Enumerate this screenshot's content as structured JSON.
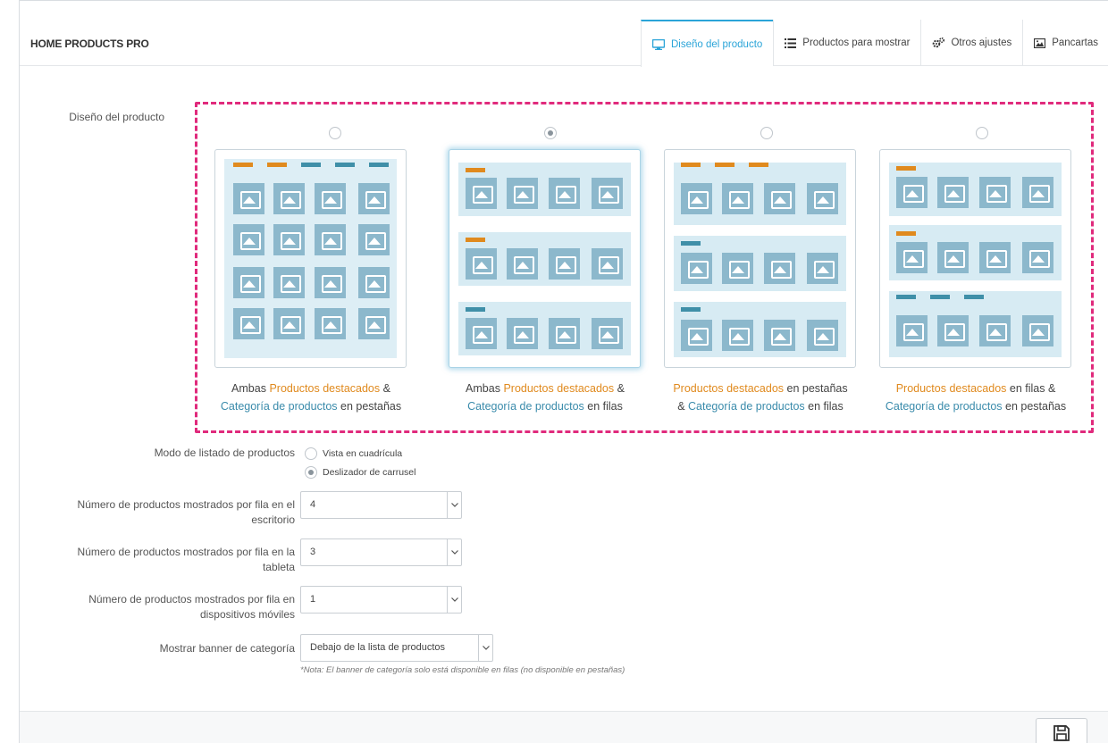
{
  "header": {
    "title": "HOME PRODUCTS PRO",
    "tabs": [
      {
        "label": "Diseño del producto",
        "icon": "monitor-icon",
        "active": true
      },
      {
        "label": "Productos para mostrar",
        "icon": "list-icon",
        "active": false
      },
      {
        "label": "Otros ajustes",
        "icon": "gears-icon",
        "active": false
      },
      {
        "label": "Pancartas",
        "icon": "image-icon",
        "active": false
      }
    ]
  },
  "layout": {
    "label": "Diseño del producto",
    "options": [
      {
        "selected": false,
        "parts": [
          "Ambas ",
          "Productos destacados",
          " &",
          "Categoría de productos",
          " en pestañas"
        ]
      },
      {
        "selected": true,
        "parts": [
          "Ambas ",
          "Productos destacados",
          " &",
          "Categoría de productos",
          " en filas"
        ]
      },
      {
        "selected": false,
        "parts": [
          "Productos destacados",
          " en pestañas",
          "& ",
          "Categoría de productos",
          " en filas"
        ]
      },
      {
        "selected": false,
        "parts": [
          "Productos destacados",
          " en filas &",
          "Categoría de productos",
          " en pestañas"
        ]
      }
    ]
  },
  "listing_mode": {
    "label": "Modo de listado de productos",
    "options": [
      {
        "label": "Vista en cuadrícula",
        "selected": false
      },
      {
        "label": "Deslizador de carrusel",
        "selected": true
      }
    ]
  },
  "desktop": {
    "label_1": "Número de productos mostrados por fila en el",
    "label_2": "escritorio",
    "value": "4"
  },
  "tablet": {
    "label_1": "Número de productos mostrados por fila en la",
    "label_2": "tableta",
    "value": "3"
  },
  "mobile": {
    "label_1": "Número de productos mostrados por fila en",
    "label_2": "dispositivos móviles",
    "value": "1"
  },
  "banner": {
    "label": "Mostrar banner de categoría",
    "value": "Debajo de la lista de productos",
    "note": "*Nota: El banner de categoría solo está disponible en filas (no disponible en pestañas)"
  },
  "colors": {
    "accent": "#2aa4d8",
    "highlight_border": "#e02a7c",
    "orange": "#e08a1e",
    "blue": "#3a8bab"
  }
}
